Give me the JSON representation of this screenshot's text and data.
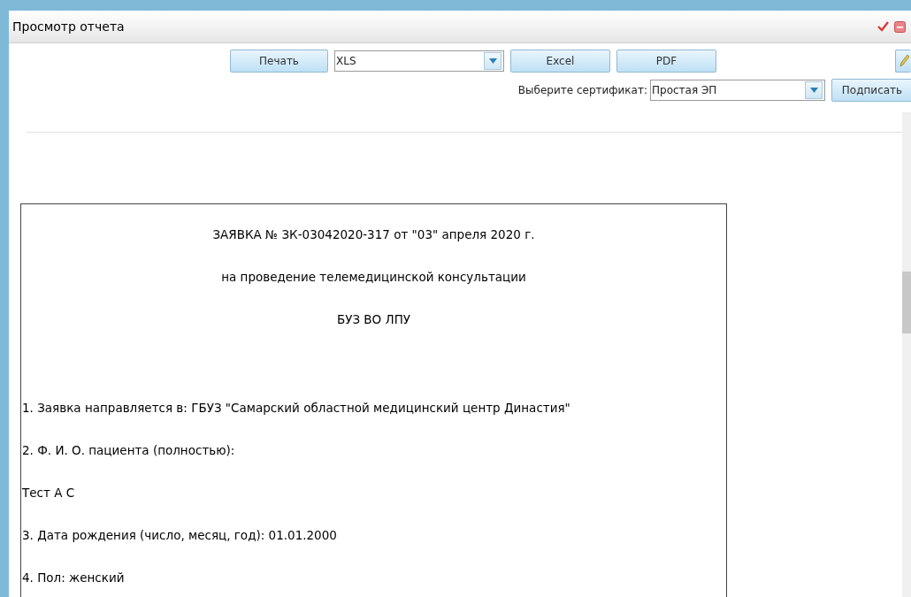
{
  "window": {
    "title": "Просмотр отчета"
  },
  "toolbar": {
    "print_button": "Печать",
    "format_select": {
      "value": "XLS"
    },
    "export_buttons": [
      "Excel",
      "PDF"
    ]
  },
  "signing": {
    "label": "Выберите сертификат:",
    "certificate_select": {
      "value": "Простая ЭП"
    },
    "sign_button": "Подписать"
  },
  "document": {
    "lines": [
      {
        "kind": "heading",
        "text": "ЗАЯВКА № ЗК-03042020-317 от \"03\" апреля 2020 г."
      },
      {
        "kind": "heading",
        "text": "на проведение телемедицинской консультации"
      },
      {
        "kind": "heading",
        "text": "БУЗ ВО ЛПУ"
      },
      {
        "kind": "gap"
      },
      {
        "kind": "text",
        "text": "1. Заявка направляется в: ГБУЗ \"Самарский областной медицинский центр Династия\""
      },
      {
        "kind": "text",
        "text": "2. Ф. И. О. пациента (полностью):"
      },
      {
        "kind": "text",
        "text": "Тест А С"
      },
      {
        "kind": "text",
        "text": "3. Дата рождения (число, месяц, год): 01.01.2000"
      },
      {
        "kind": "text",
        "text": "4. Пол: женский"
      }
    ]
  }
}
